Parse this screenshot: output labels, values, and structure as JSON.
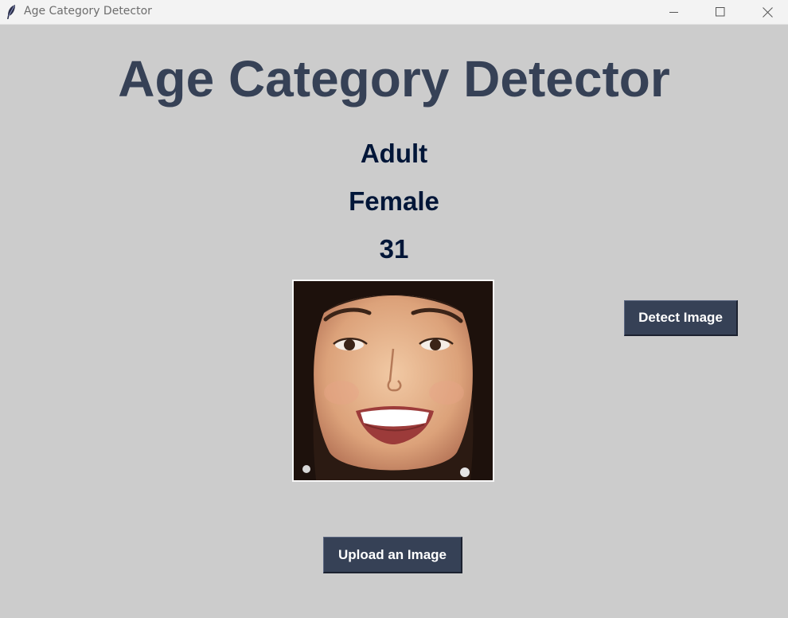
{
  "window": {
    "title": "Age Category Detector",
    "icon": "feather-icon",
    "controls": [
      "minimize-icon",
      "maximize-icon",
      "close-icon"
    ]
  },
  "main": {
    "heading": "Age Category Detector",
    "result": {
      "category": "Adult",
      "gender": "Female",
      "age": "31"
    },
    "image": {
      "content": "face-photo"
    },
    "detect_button_label": "Detect Image",
    "upload_button_label": "Upload an Image"
  },
  "colors": {
    "background": "#cccccc",
    "heading": "#364156",
    "result_text": "#011638",
    "button_bg": "#364156",
    "button_text": "#ffffff"
  }
}
